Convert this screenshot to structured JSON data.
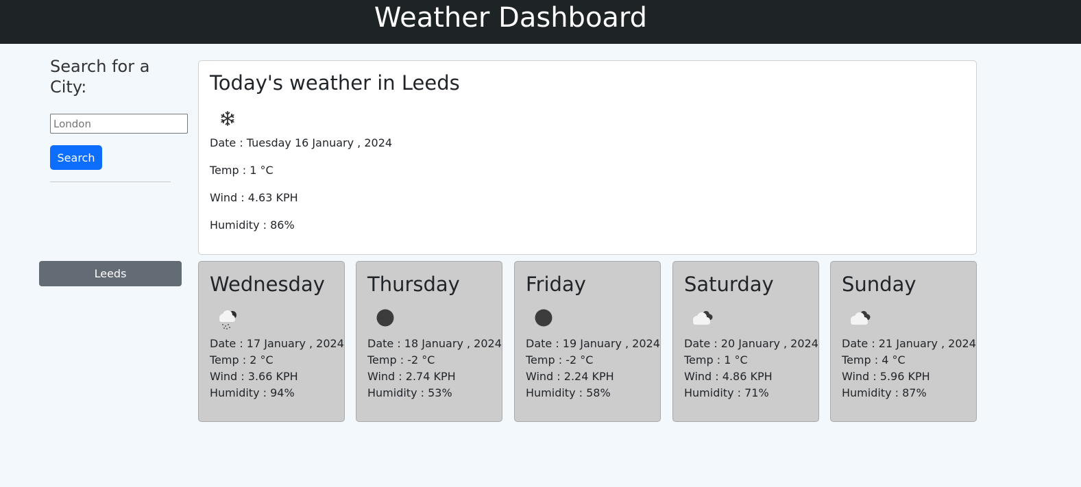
{
  "header": {
    "title": "Weather Dashboard"
  },
  "search": {
    "label": "Search for a City:",
    "placeholder": "London",
    "button_label": "Search"
  },
  "history": [
    {
      "label": "Leeds"
    }
  ],
  "today": {
    "title": "Today's weather in Leeds",
    "icon": "snowflake-icon",
    "date": "Date : Tuesday 16 January , 2024",
    "temp": "Temp : 1 °C",
    "wind": "Wind : 4.63 KPH",
    "humidity": "Humidity : 86%"
  },
  "forecast": [
    {
      "day": "Wednesday",
      "icon": "snow-cloud-icon",
      "date": "Date : 17 January , 2024",
      "temp": "Temp : 2 °C",
      "wind": "Wind : 3.66 KPH",
      "humidity": "Humidity : 94%"
    },
    {
      "day": "Thursday",
      "icon": "moon-icon",
      "date": "Date : 18 January , 2024",
      "temp": "Temp : -2 °C",
      "wind": "Wind : 2.74 KPH",
      "humidity": "Humidity : 53%"
    },
    {
      "day": "Friday",
      "icon": "moon-icon",
      "date": "Date : 19 January , 2024",
      "temp": "Temp : -2 °C",
      "wind": "Wind : 2.24 KPH",
      "humidity": "Humidity : 58%"
    },
    {
      "day": "Saturday",
      "icon": "cloudy-icon",
      "date": "Date : 20 January , 2024",
      "temp": "Temp : 1 °C",
      "wind": "Wind : 4.86 KPH",
      "humidity": "Humidity : 71%"
    },
    {
      "day": "Sunday",
      "icon": "cloudy-icon",
      "date": "Date : 21 January , 2024",
      "temp": "Temp : 4 °C",
      "wind": "Wind : 5.96 KPH",
      "humidity": "Humidity : 87%"
    }
  ],
  "colors": {
    "header_bg": "#1e2326",
    "search_button": "#0d6efd",
    "history_button": "#636c74",
    "forecast_card_bg": "#cccccc"
  }
}
